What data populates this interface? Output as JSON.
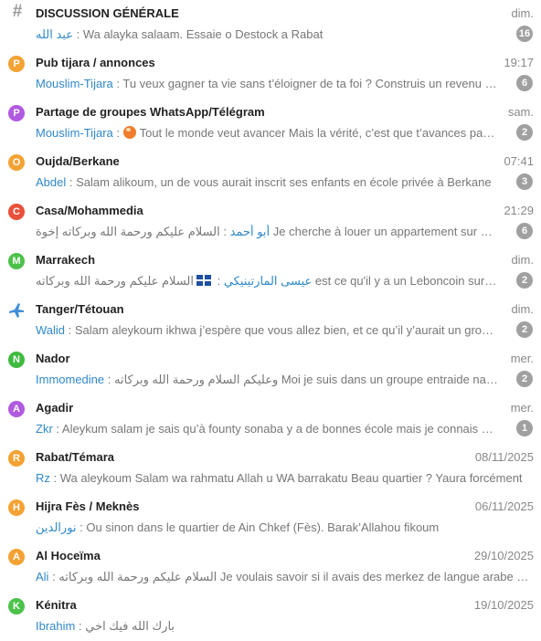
{
  "chats": [
    {
      "title": "DISCUSSION GÉNÉRALE",
      "time": "dim.",
      "sender": "عبد الله",
      "separator": " : ",
      "message": "Wa alayka salaam. Essaie o Destock a Rabat",
      "badge": "16",
      "avatar_letter": "#",
      "avatar_color": "#9a9a9a",
      "avatar_kind": "hash"
    },
    {
      "title": "Pub tijara / annonces",
      "time": "19:17",
      "sender": "Mouslim-Tijara",
      "separator": " : ",
      "message": "Tu veux gagner ta vie sans t’éloigner de ta foi ? Construis un revenu halal",
      "badge": "6",
      "avatar_letter": "P",
      "avatar_color": "#f4a233"
    },
    {
      "title": "Partage de groupes WhatsApp/Télégram",
      "time": "sam.",
      "sender": "Mouslim-Tijara",
      "separator": " : ",
      "message": "Tout le monde veut avancer Mais la vérité, c’est que t’avances pas seul",
      "badge": "2",
      "avatar_letter": "P",
      "avatar_color": "#b05ae0",
      "emoji": "sticker-icon"
    },
    {
      "title": "Oujda/Berkane",
      "time": "07:41",
      "sender": "Abdel",
      "separator": " : ",
      "message": "Salam alikoum, un de vous aurait inscrit ses enfants en école privée à Berkane",
      "badge": "3",
      "avatar_letter": "O",
      "avatar_color": "#f4a233"
    },
    {
      "title": "Casa/Mohammedia",
      "time": "21:29",
      "sender": "أبو أحمد",
      "separator": " : ",
      "message": "السلام عليكم ورحمة الله وبركاته إخوة  Je cherche à louer un appartement sur Casa, svp",
      "badge": "6",
      "avatar_letter": "C",
      "avatar_color": "#e8503a"
    },
    {
      "title": "Marrakech",
      "time": "dim.",
      "sender": "عيسى المارتينيكي",
      "separator": " : ",
      "message": "السلام عليكم ورحمة الله وبركاته  est ce qu'il y a un Leboncoin sur whatsapp",
      "badge": "2",
      "avatar_letter": "M",
      "avatar_color": "#4cc24a",
      "flag": true
    },
    {
      "title": "Tanger/Tétouan",
      "time": "dim.",
      "sender": "Walid",
      "separator": " : ",
      "message": "Salam aleykoum ikhwa j’espère que vous allez bien, et ce qu’il y’aurait un groupe",
      "badge": "2",
      "avatar_letter": "",
      "avatar_color": "#3f8fd8",
      "avatar_kind": "plane"
    },
    {
      "title": "Nador",
      "time": "mer.",
      "sender": "Immomedine",
      "separator": " : ",
      "message": "وعليكم السلام ورحمة الله وبركاته   Moi je suis dans un groupe entraide nador",
      "badge": "2",
      "avatar_letter": "N",
      "avatar_color": "#3fbb3f"
    },
    {
      "title": "Agadir",
      "time": "mer.",
      "sender": "Zkr",
      "separator": " : ",
      "message": "Aleykum salam je sais qu’à founty sonaba y a de bonnes école mais je connais pas",
      "badge": "1",
      "avatar_letter": "A",
      "avatar_color": "#b05ae0"
    },
    {
      "title": "Rabat/Témara",
      "time": "08/11/2025",
      "sender": "Rz",
      "separator": " : ",
      "message": "Wa aleykoum Salam wa rahmatu Allah u WA barrakatu   Beau quartier ?  Yaura forcément",
      "badge": "",
      "avatar_letter": "R",
      "avatar_color": "#f4a233"
    },
    {
      "title": "Hijra Fès / Meknès",
      "time": "06/11/2025",
      "sender": "نورالدين",
      "separator": " : ",
      "message": "Ou sinon dans le quartier de Ain Chkef (Fès).  Barak’Allahou fikoum",
      "badge": "",
      "avatar_letter": "H",
      "avatar_color": "#f4a233"
    },
    {
      "title": "Al Hoceïma",
      "time": "29/10/2025",
      "sender": "Ali",
      "separator": " : ",
      "message": "السلام عليكم ورحمة الله وبركاته  Je voulais savoir si il avais des merkez de langue arabe a Al Hoceima",
      "badge": "",
      "avatar_letter": "A",
      "avatar_color": "#f4a233"
    },
    {
      "title": "Kénitra",
      "time": "19/10/2025",
      "sender": "Ibrahim",
      "separator": " : ",
      "message": "بارك الله فيك اخي",
      "badge": "",
      "avatar_letter": "K",
      "avatar_color": "#4cc24a"
    }
  ]
}
